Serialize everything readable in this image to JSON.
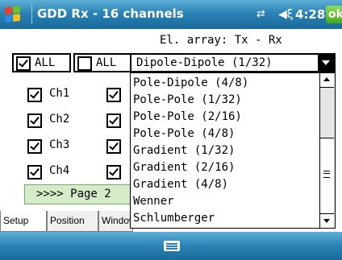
{
  "titlebar": {
    "title": "GDD Rx - 16 channels",
    "time": "4:28",
    "ok": "ok",
    "icons": [
      "windows-start-icon",
      "connectivity-icon",
      "volume-icon"
    ]
  },
  "header": {
    "el_array": "El. array: Tx - Rx"
  },
  "all_buttons": [
    {
      "label": "ALL",
      "checked": true
    },
    {
      "label": "ALL",
      "checked": false
    }
  ],
  "select": {
    "value": "Dipole-Dipole (1/32)",
    "options": [
      "Pole-Dipole (4/8)",
      "Pole-Pole (1/32)",
      "Pole-Pole (2/16)",
      "Pole-Pole (4/8)",
      "Gradient (1/32)",
      "Gradient (2/16)",
      "Gradient (4/8)",
      "Wenner",
      "Schlumberger"
    ]
  },
  "channels": [
    {
      "label": "Ch1",
      "checked": true
    },
    {
      "label": "Ch2",
      "checked": true
    },
    {
      "label": "Ch3",
      "checked": true
    },
    {
      "label": "Ch4",
      "checked": true
    }
  ],
  "page_button": {
    "label": ">>>> Page 2"
  },
  "tabs": [
    {
      "label": "Setup",
      "active": true
    },
    {
      "label": "Position",
      "active": false
    },
    {
      "label": "Window",
      "active": false
    }
  ],
  "colors": {
    "bar": "#2a82b4",
    "page_button": "#d6ecc8",
    "ok": "#45a81a"
  }
}
